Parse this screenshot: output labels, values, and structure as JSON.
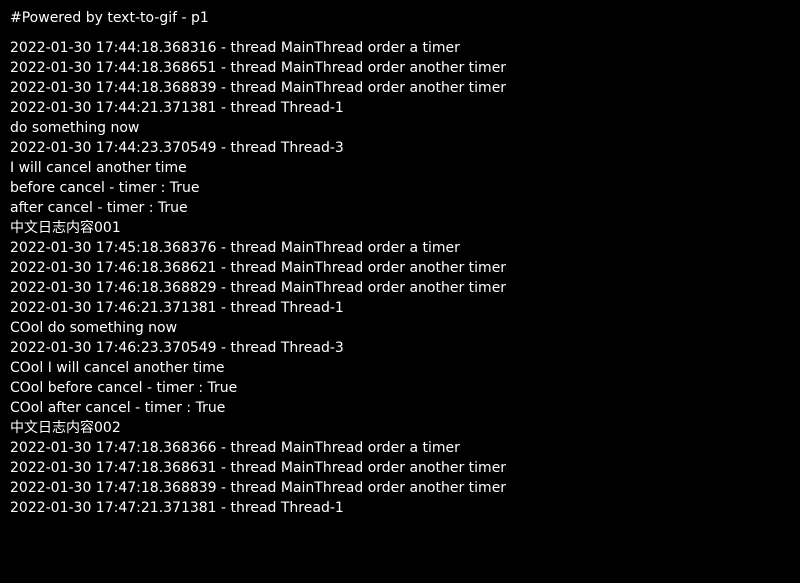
{
  "header": {
    "text": "#Powered by text-to-gif - p1"
  },
  "log_lines": [
    "2022-01-30 17:44:18.368316 - thread MainThread order a timer",
    "2022-01-30 17:44:18.368651 - thread MainThread order another timer",
    "2022-01-30 17:44:18.368839 - thread MainThread order another timer",
    "2022-01-30 17:44:21.371381 - thread Thread-1",
    "do something now",
    "2022-01-30 17:44:23.370549 - thread Thread-3",
    "I will cancel another time",
    "before cancel - timer : True",
    "after cancel - timer : True",
    "中文日志内容001",
    "2022-01-30 17:45:18.368376 - thread MainThread order a timer",
    "2022-01-30 17:46:18.368621 - thread MainThread order another timer",
    "2022-01-30 17:46:18.368829 - thread MainThread order another timer",
    "2022-01-30 17:46:21.371381 - thread Thread-1",
    "COol do something now",
    "2022-01-30 17:46:23.370549 - thread Thread-3",
    "COol I will cancel another time",
    "COol before cancel - timer : True",
    "COol after cancel - timer : True",
    "中文日志内容002",
    "2022-01-30 17:47:18.368366 - thread MainThread order a timer",
    "2022-01-30 17:47:18.368631 - thread MainThread order another timer",
    "2022-01-30 17:47:18.368839 - thread MainThread order another timer",
    "2022-01-30 17:47:21.371381 - thread Thread-1"
  ]
}
